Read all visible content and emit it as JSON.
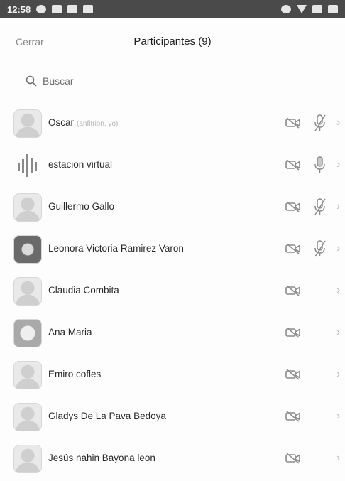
{
  "status_bar": {
    "time": "12:58"
  },
  "header": {
    "close_label": "Cerrar",
    "title": "Participantes (9)"
  },
  "search": {
    "placeholder": "Buscar"
  },
  "participants": [
    {
      "name": "Oscar",
      "note": "(anfitrión, yo)",
      "video": "off",
      "mic": "muted",
      "avatar": "default"
    },
    {
      "name": "estacion virtual",
      "video": "off",
      "mic": "on",
      "avatar": "bars"
    },
    {
      "name": "Guillermo Gallo",
      "video": "off",
      "mic": "muted",
      "avatar": "default"
    },
    {
      "name": "Leonora Victoria Ramirez Varon",
      "video": "off",
      "mic": "muted",
      "avatar": "dark"
    },
    {
      "name": "Claudia Combita",
      "video": "off",
      "mic": "none",
      "avatar": "default"
    },
    {
      "name": "Ana Maria",
      "video": "off",
      "mic": "none",
      "avatar": "mid"
    },
    {
      "name": "Emiro cofles",
      "video": "off",
      "mic": "none",
      "avatar": "default"
    },
    {
      "name": "Gladys De La Pava Bedoya",
      "video": "off",
      "mic": "none",
      "avatar": "default"
    },
    {
      "name": "Jesús nahin Bayona leon",
      "video": "off",
      "mic": "none",
      "avatar": "default"
    }
  ]
}
